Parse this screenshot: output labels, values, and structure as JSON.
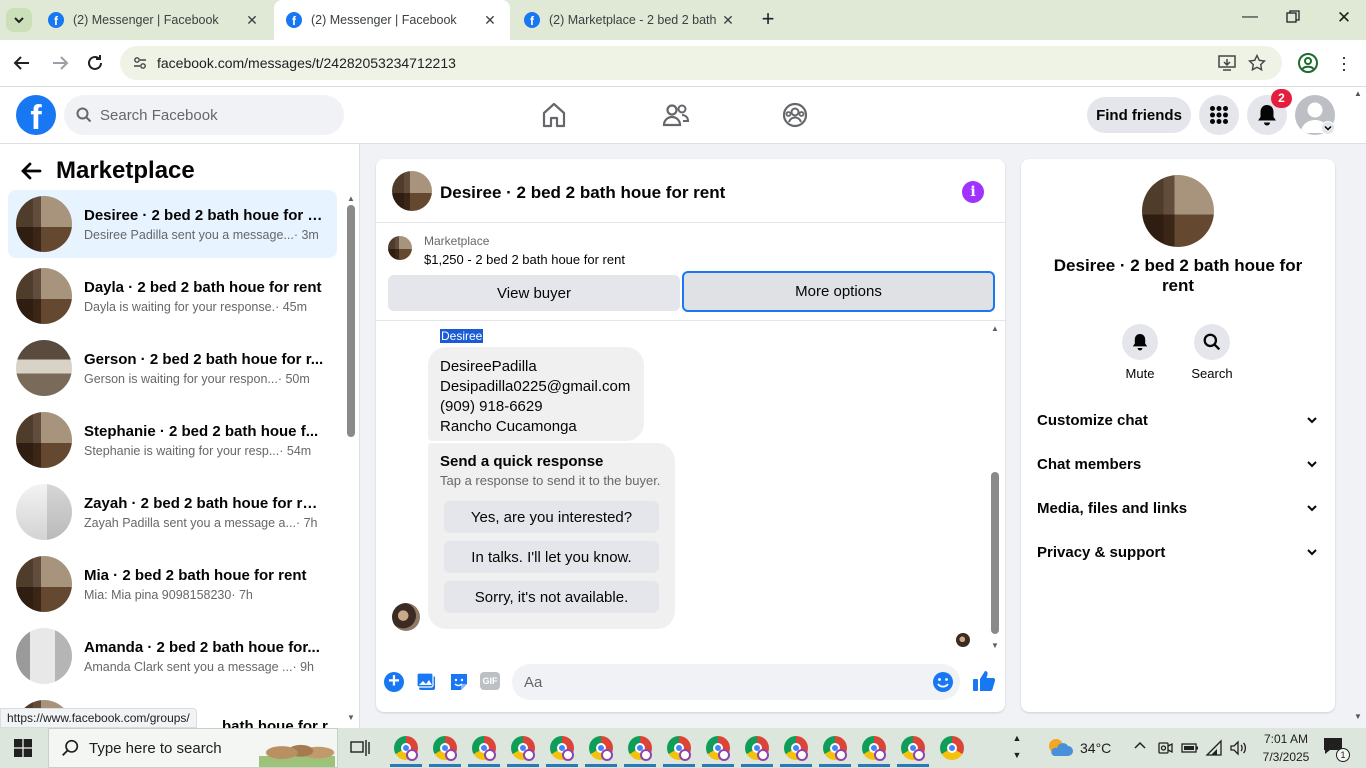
{
  "browser": {
    "tabs": [
      {
        "title": "(2) Messenger | Facebook",
        "active": false
      },
      {
        "title": "(2) Messenger | Facebook",
        "active": true
      },
      {
        "title": "(2) Marketplace - 2 bed 2 bath h",
        "active": false
      }
    ],
    "url": "facebook.com/messages/t/24282053234712213",
    "status_url": "https://www.facebook.com/groups/"
  },
  "header": {
    "search_placeholder": "Search Facebook",
    "find_friends": "Find friends",
    "notifications_count": "2"
  },
  "sidebar": {
    "title": "Marketplace",
    "conversations": [
      {
        "name": "Desiree · 2 bed 2 bath houe for r...",
        "preview": "Desiree Padilla sent you a message...",
        "time": "· 3m",
        "active": true
      },
      {
        "name": "Dayla · 2 bed 2 bath houe for rent",
        "preview": "Dayla is waiting for your response.",
        "time": "· 45m"
      },
      {
        "name": "Gerson · 2 bed 2 bath houe for r...",
        "preview": "Gerson is waiting for your respon...",
        "time": "· 50m"
      },
      {
        "name": "Stephanie · 2 bed 2 bath houe f...",
        "preview": "Stephanie is waiting for your resp...",
        "time": "· 54m"
      },
      {
        "name": "Zayah · 2 bed 2 bath houe for rent",
        "preview": "Zayah Padilla sent you a message a...",
        "time": "· 7h"
      },
      {
        "name": "Mia · 2 bed 2 bath houe for rent",
        "preview": "Mia: Mia pina 9098158230",
        "time": "· 7h"
      },
      {
        "name": "Amanda · 2 bed 2 bath houe for...",
        "preview": "Amanda Clark sent you a message ...",
        "time": "· 9h"
      },
      {
        "name": "bath houe for r...",
        "preview": "",
        "time": ""
      }
    ]
  },
  "chat": {
    "title": "Desiree · 2 bed 2 bath houe for rent",
    "listing_label": "Marketplace",
    "listing_detail": "$1,250 - 2 bed 2 bath houe for rent",
    "view_buyer": "View buyer",
    "more_options": "More options",
    "sender_label": "Desiree",
    "message_lines": [
      "DesireePadilla",
      "Desipadilla0225@gmail.com",
      "(909) 918-6629",
      "Rancho Cucamonga"
    ],
    "quick_title": "Send a quick response",
    "quick_sub": "Tap a response to send it to the buyer.",
    "quick_responses": [
      "Yes, are you interested?",
      "In talks. I'll let you know.",
      "Sorry, it's not available."
    ],
    "composer_placeholder": "Aa"
  },
  "info_panel": {
    "title": "Desiree · 2 bed 2 bath houe for rent",
    "mute": "Mute",
    "search": "Search",
    "sections": [
      "Customize chat",
      "Chat members",
      "Media, files and links",
      "Privacy & support"
    ]
  },
  "taskbar": {
    "search_placeholder": "Type here to search",
    "weather": "34°C",
    "time": "7:01 AM",
    "date": "7/3/2025",
    "notif_count": "1"
  },
  "colors": {
    "brand": "#1877f2",
    "messenger_purple": "#a033ff"
  }
}
